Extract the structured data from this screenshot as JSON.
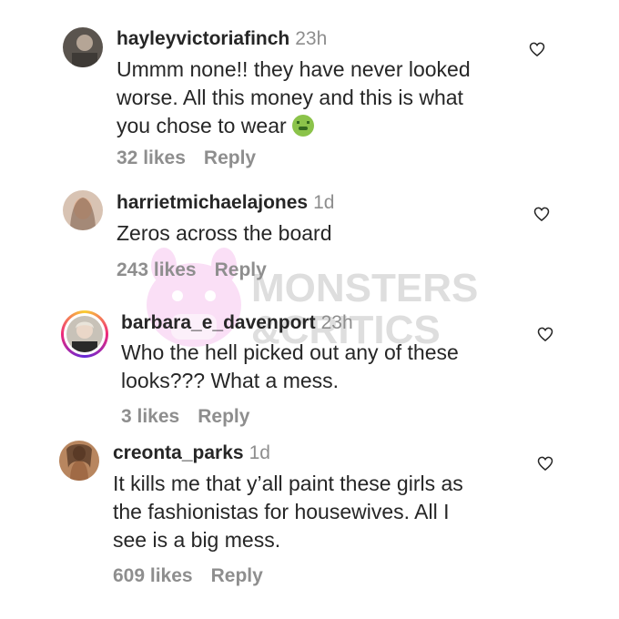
{
  "comments": [
    {
      "username": "hayleyvictoriafinch",
      "time": "23h",
      "lines": [
        "Ummm none!! they have never looked",
        "worse. All this money and this is what",
        "you chose to wear"
      ],
      "likes": "32 likes",
      "reply": "Reply",
      "avatar_color": "#6b6157",
      "emoji": "nauseated-face-emoji"
    },
    {
      "username": "harrietmichaelajones",
      "time": "1d",
      "lines": [
        "Zeros across the board"
      ],
      "likes": "243 likes",
      "reply": "Reply",
      "avatar_color": "#c9a58c"
    },
    {
      "username": "barbara_e_davenport",
      "time": "23h",
      "lines": [
        "Who the hell picked out any of these",
        "looks??? What a mess."
      ],
      "likes": "3 likes",
      "reply": "Reply",
      "avatar_color": "#b9b2a6",
      "has_story_ring": true
    },
    {
      "username": "creonta_parks",
      "time": "1d",
      "lines": [
        "It kills me that y’all paint these girls as",
        "the fashionistas for housewives. All I",
        "see is a big mess."
      ],
      "likes": "609 likes",
      "reply": "Reply",
      "avatar_color": "#9c6a4a"
    }
  ],
  "icons": {
    "like": "heart-outline-icon"
  },
  "watermark": {
    "line1": "MONSTERS",
    "line2": "&CRITICS",
    "mascot_color": "#f7c6ef",
    "text_color": "#d9d9d9"
  }
}
